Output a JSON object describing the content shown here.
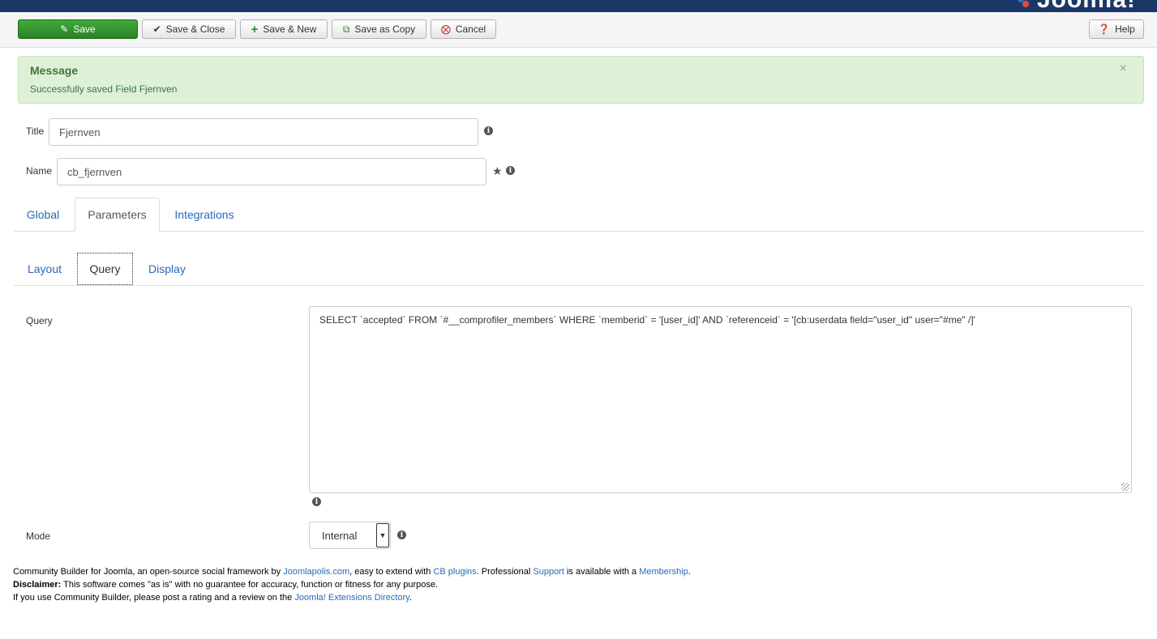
{
  "brand": {
    "logo_text": "Joomla!"
  },
  "toolbar": {
    "save": "Save",
    "save_close": "Save & Close",
    "save_new": "Save & New",
    "save_copy": "Save as Copy",
    "cancel": "Cancel",
    "help": "Help"
  },
  "message": {
    "heading": "Message",
    "text": "Successfully saved Field Fjernven",
    "close": "×"
  },
  "form": {
    "title_label": "Title",
    "title_value": "Fjernven",
    "name_label": "Name",
    "name_value": "cb_fjernven"
  },
  "tabs": [
    {
      "label": "Global",
      "active": false
    },
    {
      "label": "Parameters",
      "active": true
    },
    {
      "label": "Integrations",
      "active": false
    }
  ],
  "subtabs": [
    {
      "label": "Layout",
      "active": false
    },
    {
      "label": "Query",
      "active": true
    },
    {
      "label": "Display",
      "active": false
    }
  ],
  "query": {
    "label": "Query",
    "value": "SELECT `accepted` FROM `#__comprofiler_members` WHERE `memberid` = '[user_id]' AND `referenceid` = '[cb:userdata field=\"user_id\" user=\"#me\" /]'"
  },
  "mode": {
    "label": "Mode",
    "value": "Internal"
  },
  "footer": {
    "line1_a": "Community Builder for Joomla, an open-source social framework by ",
    "link_joomlapolis": "Joomlapolis.com",
    "line1_b": ", easy to extend with ",
    "link_cb_plugins": "CB plugins",
    "line1_c": ". Professional ",
    "link_support": "Support",
    "line1_d": " is available with a ",
    "link_membership": "Membership",
    "line1_e": ".",
    "disclaimer_label": "Disclaimer:",
    "disclaimer_text": " This software comes \"as is\" with no guarantee for accuracy, function or fitness for any purpose.",
    "line3_a": "If you use Community Builder, please post a rating and a review on the ",
    "link_jed": "Joomla! Extensions Directory",
    "line3_b": "."
  },
  "colors": {
    "topbar": "#1a3867",
    "save_button": "#2c8227",
    "alert_bg": "#dff0d8",
    "link": "#2a69b8"
  }
}
